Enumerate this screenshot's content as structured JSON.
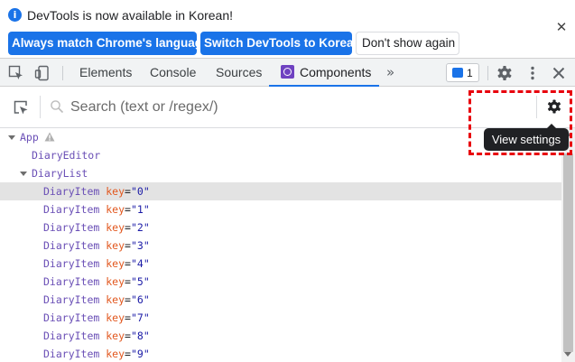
{
  "infobar": {
    "icon": "info-icon",
    "message": "DevTools is now available in Korean!",
    "buttons": {
      "match_language": "Always match Chrome's language",
      "switch_korean": "Switch DevTools to Korean",
      "dont_show": "Don't show again"
    },
    "close_glyph": "✕"
  },
  "toolbar": {
    "tabs": [
      "Elements",
      "Console",
      "Sources",
      "Components"
    ],
    "active_tab": "Components",
    "more_tabs_glyph": "»",
    "message_count": "1",
    "icons": [
      "inspect-element-icon",
      "device-toolbar-icon",
      "settings-gear-icon",
      "kebab-menu-icon",
      "close-icon"
    ]
  },
  "components": {
    "search_placeholder": "Search (text or /regex/)",
    "tooltip": "View settings",
    "tree": {
      "app": "App",
      "diary_editor": "DiaryEditor",
      "diary_list": "DiaryList",
      "item_name": "DiaryItem",
      "prop_key": "key",
      "equals": "=",
      "items": [
        "\"0\"",
        "\"1\"",
        "\"2\"",
        "\"3\"",
        "\"4\"",
        "\"5\"",
        "\"6\"",
        "\"7\"",
        "\"8\"",
        "\"9\""
      ],
      "selected_index": 0
    }
  },
  "colors": {
    "accent": "#1a73e8",
    "component_name": "#6a4fb6",
    "prop_key": "#e2571e",
    "prop_value": "#1a1aa6",
    "selection": "#e3e3e3",
    "annotation": "#e8000c"
  }
}
